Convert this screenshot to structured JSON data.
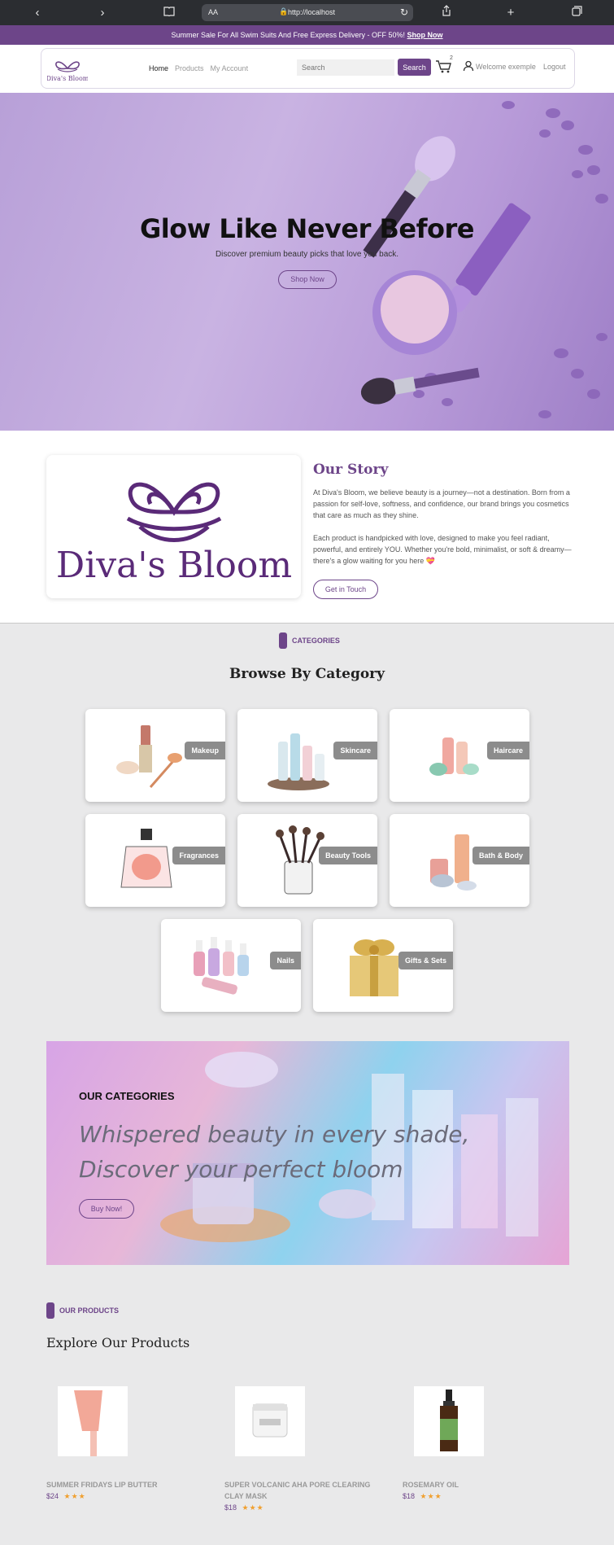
{
  "browser": {
    "text_size": "AA",
    "url": "http://localhost"
  },
  "promo": {
    "text": "Summer Sale For All Swim Suits And Free Express Delivery - OFF 50%!",
    "link": "Shop Now"
  },
  "header": {
    "logo_text": "Diva's Bloom",
    "nav": [
      "Home",
      "Products",
      "My Account"
    ],
    "search_placeholder": "Search",
    "search_button": "Search",
    "cart_count": "2",
    "welcome": "Welcome exemple",
    "logout": "Logout"
  },
  "hero": {
    "title": "Glow Like Never Before",
    "subtitle": "Discover premium beauty picks that love you back.",
    "button": "Shop Now"
  },
  "story": {
    "logo_text": "Diva's Bloom",
    "title": "Our Story",
    "p1": "At Diva's Bloom, we believe beauty is a journey—not a destination. Born from a passion for self-love, softness, and confidence, our brand brings you cosmetics that care as much as they shine.",
    "p2": "Each product is handpicked with love, designed to make you feel radiant, powerful, and entirely YOU. Whether you're bold, minimalist, or soft & dreamy—there's a glow waiting for you here 💝",
    "button": "Get in Touch"
  },
  "categories": {
    "label": "CATEGORIES",
    "title": "Browse By Category",
    "items": [
      "Makeup",
      "Skincare",
      "Haircare",
      "Fragrances",
      "Beauty Tools",
      "Bath & Body",
      "Nails",
      "Gifts & Sets"
    ]
  },
  "banner": {
    "label": "OUR CATEGORIES",
    "line1": "Whispered beauty in every shade,",
    "line2": "Discover your perfect bloom",
    "button": "Buy Now!"
  },
  "products": {
    "label": "OUR PRODUCTS",
    "title": "Explore Our Products",
    "items": [
      {
        "name": "SUMMER FRIDAYS LIP BUTTER",
        "price": "$24",
        "stars": "★★★"
      },
      {
        "name": "SUPER VOLCANIC AHA PORE CLEARING CLAY MASK",
        "price": "$18",
        "stars": "★★★"
      },
      {
        "name": "ROSEMARY OIL",
        "price": "$18",
        "stars": "★★★"
      }
    ]
  },
  "colors": {
    "brand": "#6d4589",
    "hero_bg": "#c9b3e2",
    "star": "#f0a030"
  }
}
